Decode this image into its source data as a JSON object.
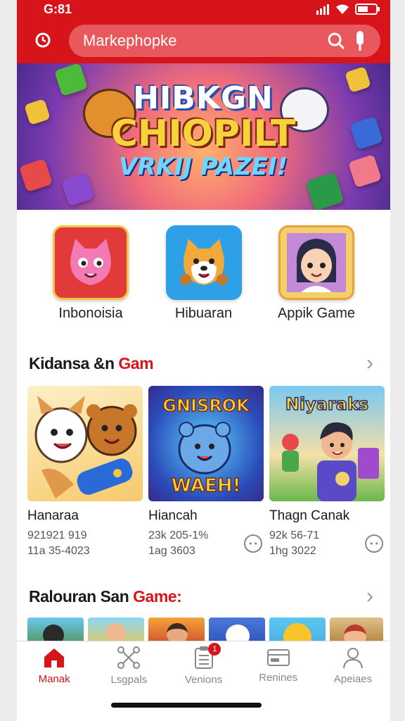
{
  "status_bar": {
    "time": "G:81"
  },
  "search": {
    "placeholder": "Markephopke"
  },
  "banner": {
    "line1": "HIBKGN",
    "line2": "CHIOPILT",
    "line3": "VRKIJ PAZEI!"
  },
  "quick_items": [
    {
      "label": "Inbonoisia",
      "icon": "pink-cat-icon"
    },
    {
      "label": "Hibuaran",
      "icon": "shiba-dog-icon"
    },
    {
      "label": "Appik Game",
      "icon": "girl-avatar-icon"
    }
  ],
  "section1": {
    "title": "Kidansa &n",
    "title_accent": "Gam",
    "cards": [
      {
        "title": "Hanaraa",
        "meta1": "921921 919",
        "meta2": "11a 35-4023",
        "art_text": ""
      },
      {
        "title": "Hiancah",
        "meta1": "23k 205-1%",
        "meta2": "1ag 3603",
        "art_text": "GNISROK WAEH!"
      },
      {
        "title": "Thagn Canak",
        "meta1": "92k 56-71",
        "meta2": "1hg 3022",
        "art_text": "Niyaraks"
      }
    ]
  },
  "section2": {
    "title": "Ralouran San",
    "title_accent": "Game:"
  },
  "tabs": [
    {
      "label": "Manak",
      "icon": "home-icon",
      "active": true
    },
    {
      "label": "Lsgpals",
      "icon": "network-icon",
      "active": false
    },
    {
      "label": "Venions",
      "icon": "clipboard-icon",
      "active": false,
      "badge": "1"
    },
    {
      "label": "Renines",
      "icon": "card-icon",
      "active": false
    },
    {
      "label": "Apeiaes",
      "icon": "user-icon",
      "active": false
    }
  ],
  "colors": {
    "brand_red": "#d7141a"
  }
}
